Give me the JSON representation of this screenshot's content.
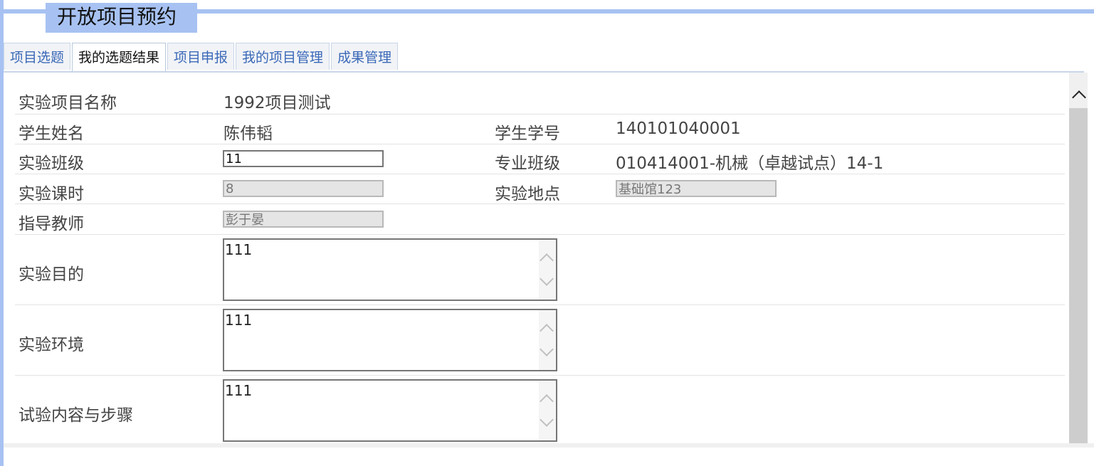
{
  "page_title": "开放项目预约",
  "tabs": [
    {
      "label": "项目选题",
      "active": false
    },
    {
      "label": "我的选题结果",
      "active": true
    },
    {
      "label": "项目申报",
      "active": false
    },
    {
      "label": "我的项目管理",
      "active": false
    },
    {
      "label": "成果管理",
      "active": false
    }
  ],
  "form": {
    "project_name": {
      "label": "实验项目名称",
      "value": "1992项目测试"
    },
    "student_name": {
      "label": "学生姓名",
      "value": "陈伟韬"
    },
    "student_id": {
      "label": "学生学号",
      "value": "140101040001"
    },
    "exp_class": {
      "label": "实验班级",
      "value": "11"
    },
    "major_class": {
      "label": "专业班级",
      "value": "010414001-机械（卓越试点）14-1"
    },
    "hours": {
      "label": "实验课时",
      "value": "8"
    },
    "location": {
      "label": "实验地点",
      "value": "基础馆123"
    },
    "teacher": {
      "label": "指导教师",
      "value": "彭于晏"
    },
    "purpose": {
      "label": "实验目的",
      "value": "111"
    },
    "environment": {
      "label": "实验环境",
      "value": "111"
    },
    "content": {
      "label": "试验内容与步骤",
      "value": "111"
    }
  },
  "colors": {
    "accent": "#a7c2f2",
    "tab_text": "#3a68b8"
  }
}
